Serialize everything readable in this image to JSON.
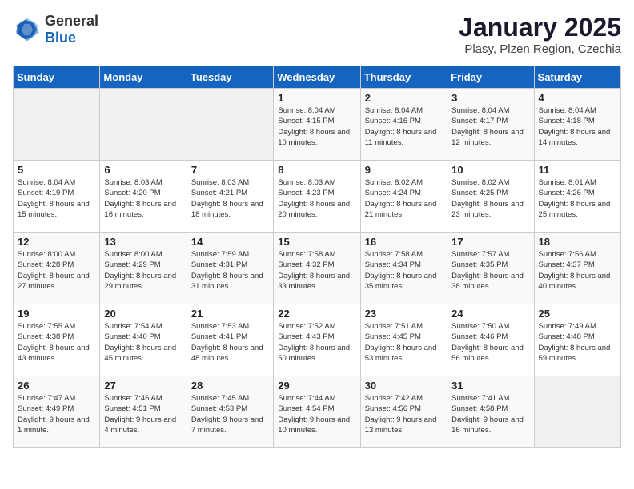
{
  "header": {
    "logo_general": "General",
    "logo_blue": "Blue",
    "month_year": "January 2025",
    "location": "Plasy, Plzen Region, Czechia"
  },
  "days_of_week": [
    "Sunday",
    "Monday",
    "Tuesday",
    "Wednesday",
    "Thursday",
    "Friday",
    "Saturday"
  ],
  "weeks": [
    [
      {
        "day": "",
        "detail": ""
      },
      {
        "day": "",
        "detail": ""
      },
      {
        "day": "",
        "detail": ""
      },
      {
        "day": "1",
        "detail": "Sunrise: 8:04 AM\nSunset: 4:15 PM\nDaylight: 8 hours\nand 10 minutes."
      },
      {
        "day": "2",
        "detail": "Sunrise: 8:04 AM\nSunset: 4:16 PM\nDaylight: 8 hours\nand 11 minutes."
      },
      {
        "day": "3",
        "detail": "Sunrise: 8:04 AM\nSunset: 4:17 PM\nDaylight: 8 hours\nand 12 minutes."
      },
      {
        "day": "4",
        "detail": "Sunrise: 8:04 AM\nSunset: 4:18 PM\nDaylight: 8 hours\nand 14 minutes."
      }
    ],
    [
      {
        "day": "5",
        "detail": "Sunrise: 8:04 AM\nSunset: 4:19 PM\nDaylight: 8 hours\nand 15 minutes."
      },
      {
        "day": "6",
        "detail": "Sunrise: 8:03 AM\nSunset: 4:20 PM\nDaylight: 8 hours\nand 16 minutes."
      },
      {
        "day": "7",
        "detail": "Sunrise: 8:03 AM\nSunset: 4:21 PM\nDaylight: 8 hours\nand 18 minutes."
      },
      {
        "day": "8",
        "detail": "Sunrise: 8:03 AM\nSunset: 4:23 PM\nDaylight: 8 hours\nand 20 minutes."
      },
      {
        "day": "9",
        "detail": "Sunrise: 8:02 AM\nSunset: 4:24 PM\nDaylight: 8 hours\nand 21 minutes."
      },
      {
        "day": "10",
        "detail": "Sunrise: 8:02 AM\nSunset: 4:25 PM\nDaylight: 8 hours\nand 23 minutes."
      },
      {
        "day": "11",
        "detail": "Sunrise: 8:01 AM\nSunset: 4:26 PM\nDaylight: 8 hours\nand 25 minutes."
      }
    ],
    [
      {
        "day": "12",
        "detail": "Sunrise: 8:00 AM\nSunset: 4:28 PM\nDaylight: 8 hours\nand 27 minutes."
      },
      {
        "day": "13",
        "detail": "Sunrise: 8:00 AM\nSunset: 4:29 PM\nDaylight: 8 hours\nand 29 minutes."
      },
      {
        "day": "14",
        "detail": "Sunrise: 7:59 AM\nSunset: 4:31 PM\nDaylight: 8 hours\nand 31 minutes."
      },
      {
        "day": "15",
        "detail": "Sunrise: 7:58 AM\nSunset: 4:32 PM\nDaylight: 8 hours\nand 33 minutes."
      },
      {
        "day": "16",
        "detail": "Sunrise: 7:58 AM\nSunset: 4:34 PM\nDaylight: 8 hours\nand 35 minutes."
      },
      {
        "day": "17",
        "detail": "Sunrise: 7:57 AM\nSunset: 4:35 PM\nDaylight: 8 hours\nand 38 minutes."
      },
      {
        "day": "18",
        "detail": "Sunrise: 7:56 AM\nSunset: 4:37 PM\nDaylight: 8 hours\nand 40 minutes."
      }
    ],
    [
      {
        "day": "19",
        "detail": "Sunrise: 7:55 AM\nSunset: 4:38 PM\nDaylight: 8 hours\nand 43 minutes."
      },
      {
        "day": "20",
        "detail": "Sunrise: 7:54 AM\nSunset: 4:40 PM\nDaylight: 8 hours\nand 45 minutes."
      },
      {
        "day": "21",
        "detail": "Sunrise: 7:53 AM\nSunset: 4:41 PM\nDaylight: 8 hours\nand 48 minutes."
      },
      {
        "day": "22",
        "detail": "Sunrise: 7:52 AM\nSunset: 4:43 PM\nDaylight: 8 hours\nand 50 minutes."
      },
      {
        "day": "23",
        "detail": "Sunrise: 7:51 AM\nSunset: 4:45 PM\nDaylight: 8 hours\nand 53 minutes."
      },
      {
        "day": "24",
        "detail": "Sunrise: 7:50 AM\nSunset: 4:46 PM\nDaylight: 8 hours\nand 56 minutes."
      },
      {
        "day": "25",
        "detail": "Sunrise: 7:49 AM\nSunset: 4:48 PM\nDaylight: 8 hours\nand 59 minutes."
      }
    ],
    [
      {
        "day": "26",
        "detail": "Sunrise: 7:47 AM\nSunset: 4:49 PM\nDaylight: 9 hours\nand 1 minute."
      },
      {
        "day": "27",
        "detail": "Sunrise: 7:46 AM\nSunset: 4:51 PM\nDaylight: 9 hours\nand 4 minutes."
      },
      {
        "day": "28",
        "detail": "Sunrise: 7:45 AM\nSunset: 4:53 PM\nDaylight: 9 hours\nand 7 minutes."
      },
      {
        "day": "29",
        "detail": "Sunrise: 7:44 AM\nSunset: 4:54 PM\nDaylight: 9 hours\nand 10 minutes."
      },
      {
        "day": "30",
        "detail": "Sunrise: 7:42 AM\nSunset: 4:56 PM\nDaylight: 9 hours\nand 13 minutes."
      },
      {
        "day": "31",
        "detail": "Sunrise: 7:41 AM\nSunset: 4:58 PM\nDaylight: 9 hours\nand 16 minutes."
      },
      {
        "day": "",
        "detail": ""
      }
    ]
  ]
}
